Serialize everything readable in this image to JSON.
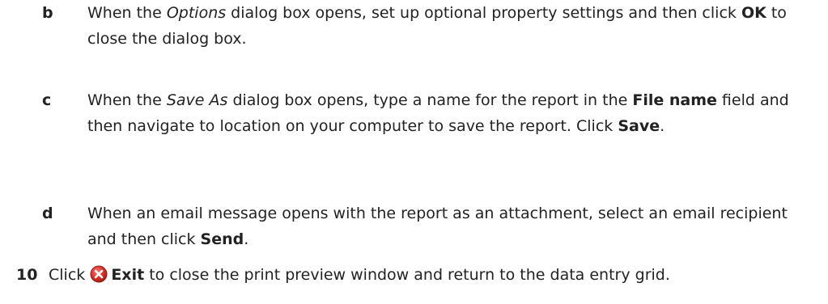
{
  "steps": {
    "b": {
      "marker": "b",
      "t1": "When the ",
      "t2": "Options",
      "t3": " dialog box opens, set up optional property settings and then click ",
      "t4": "OK",
      "t5": " to close the dialog box."
    },
    "c": {
      "marker": "c",
      "t1": "When the ",
      "t2": "Save As",
      "t3": " dialog box opens, type a name for the report in the ",
      "t4": "File name",
      "t5": " field and then navigate to location on your computer to save the report. Click ",
      "t6": "Save",
      "t7": "."
    },
    "d": {
      "marker": "d",
      "t1": "When an email message opens with the report as an attachment, select an email recipient and then click ",
      "t2": "Send",
      "t3": "."
    },
    "s10": {
      "marker": "10",
      "t1": "Click ",
      "icon": "exit-icon",
      "t2": "Exit",
      "t3": " to close the print preview window and return to the data entry grid."
    }
  },
  "colors": {
    "text": "#222222",
    "exit_icon": "#d9342b"
  }
}
